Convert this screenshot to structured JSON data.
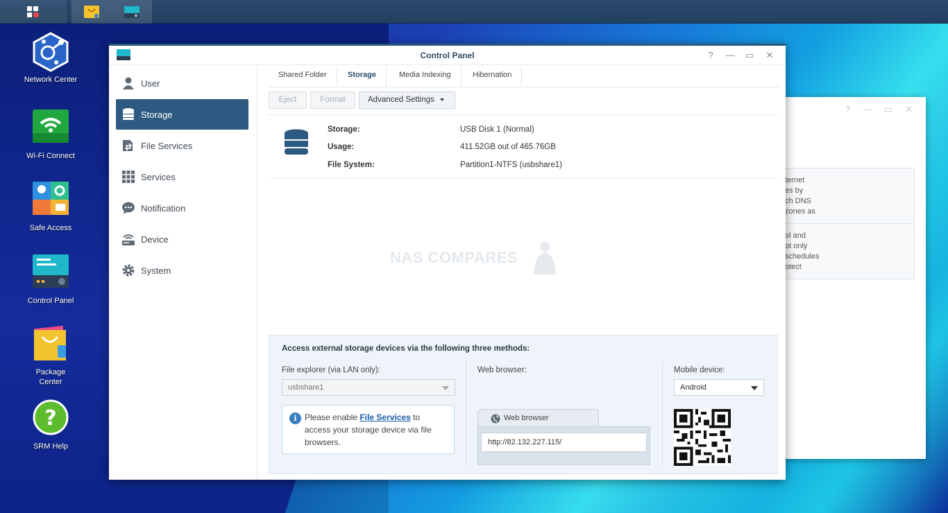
{
  "window": {
    "title": "Control Panel",
    "help": "?",
    "minimize": "—",
    "maximize": "▭",
    "close": "✕"
  },
  "desktop": {
    "icons": [
      {
        "label": "Network Center"
      },
      {
        "label": "Wi-Fi Connect"
      },
      {
        "label": "Safe Access"
      },
      {
        "label": "Control Panel"
      },
      {
        "label": "Package Center"
      },
      {
        "label": "SRM Help"
      }
    ]
  },
  "sidebar": {
    "items": [
      {
        "label": "User",
        "icon": "user-icon"
      },
      {
        "label": "Storage",
        "icon": "storage-icon",
        "active": true
      },
      {
        "label": "File Services",
        "icon": "file-services-icon"
      },
      {
        "label": "Services",
        "icon": "services-icon"
      },
      {
        "label": "Notification",
        "icon": "notification-icon"
      },
      {
        "label": "Device",
        "icon": "device-icon"
      },
      {
        "label": "System",
        "icon": "system-icon"
      }
    ]
  },
  "tabs": [
    "Shared Folder",
    "Storage",
    "Media Indexing",
    "Hibernation"
  ],
  "toolbar": {
    "eject": "Eject",
    "format": "Format",
    "advanced": "Advanced Settings"
  },
  "info": {
    "storage_label": "Storage:",
    "storage_value": "USB Disk 1 (Normal)",
    "usage_label": "Usage:",
    "usage_value": "411.52GB out of 465.76GB",
    "fs_label": "File System:",
    "fs_value": "Partition1-NTFS (usbshare1)"
  },
  "watermark": "NAS COMPARES",
  "methods": {
    "title": "Access external storage devices via the following three methods:",
    "explorer_label": "File explorer (via LAN only):",
    "explorer_value": "usbshare1",
    "note_before": "Please enable ",
    "note_link": "File Services",
    "note_after": " to access your storage device via file browsers.",
    "web_label": "Web browser:",
    "browser_tab": "Web browser",
    "url": "http://82.132.227.115/",
    "mobile_label": "Mobile device:",
    "mobile_value": "Android"
  },
  "back_window": {
    "help": "?",
    "minimize": "—",
    "maximize": "▭",
    "close": "✕",
    "panel1": [
      "ternet",
      "es by",
      "ch DNS",
      "zones as"
    ],
    "panel2": [
      "ol and",
      "ot only",
      "schedules",
      "otect"
    ]
  },
  "colors": {
    "accent": "#2d5a80",
    "link": "#1a5fa8"
  }
}
